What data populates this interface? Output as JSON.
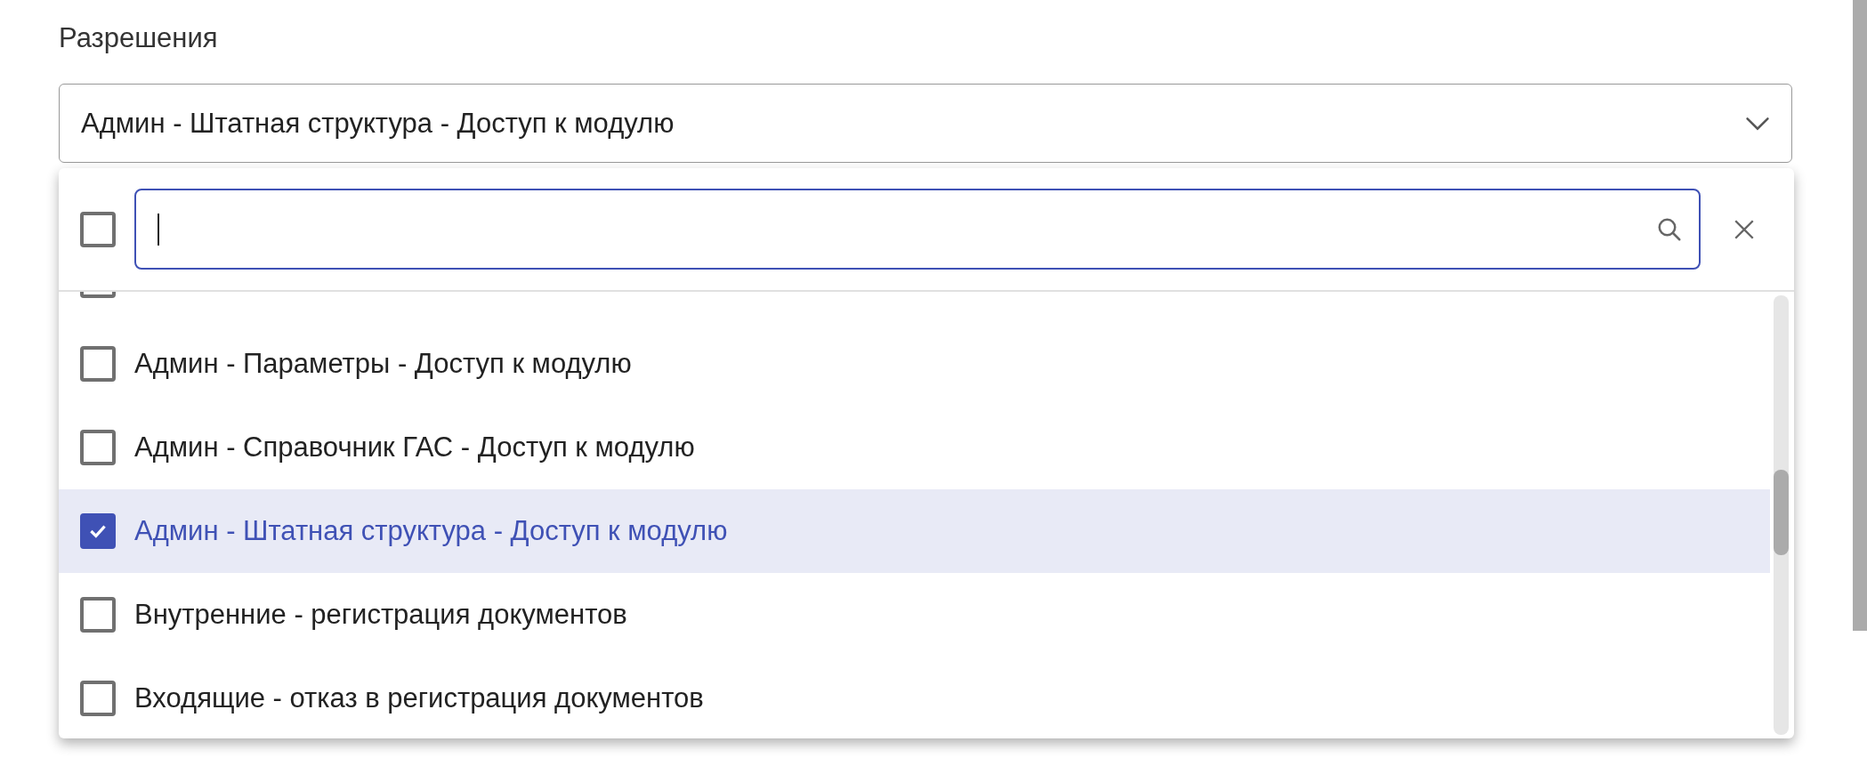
{
  "field_label": "Разрешения",
  "select": {
    "value": "Админ - Штатная структура - Доступ к модулю",
    "expanded": true
  },
  "dropdown": {
    "select_all_checked": false,
    "search": {
      "focused": true
    },
    "items": [
      {
        "checked": false
      },
      {
        "label": "Админ - Параметры - Доступ к модулю",
        "checked": false,
        "selected": false
      },
      {
        "label": "Админ - Справочник ГАС - Доступ к модулю",
        "checked": false,
        "selected": false
      },
      {
        "label": "Админ - Штатная структура - Доступ к модулю",
        "checked": true,
        "selected": true
      },
      {
        "label": "Внутренние - регистрация документов",
        "checked": false,
        "selected": false
      },
      {
        "label": "Входящие - отказ в регистрация документов",
        "checked": false,
        "selected": false
      }
    ]
  }
}
